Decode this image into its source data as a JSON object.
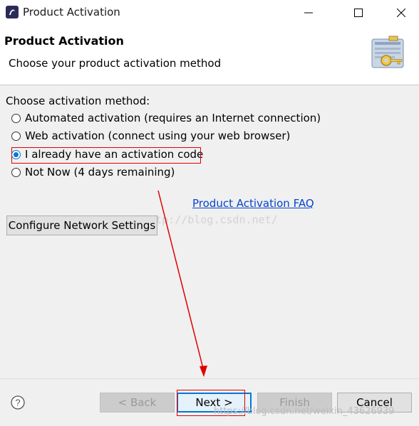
{
  "window": {
    "title": "Product Activation",
    "app_icon": "app-logo-icon",
    "controls": {
      "minimize": "minimize-icon",
      "maximize": "maximize-icon",
      "close": "close-icon"
    }
  },
  "header": {
    "title": "Product Activation",
    "subtitle": "Choose your product activation method",
    "icon": "license-key-icon"
  },
  "main": {
    "section_label": "Choose activation method:",
    "options": [
      {
        "label": "Automated activation (requires an Internet connection)",
        "checked": false
      },
      {
        "label": "Web activation (connect using your web browser)",
        "checked": false
      },
      {
        "label": "I already have an activation code",
        "checked": true
      },
      {
        "label": "Not Now (4 days remaining)",
        "checked": false
      }
    ],
    "faq_link": "Product Activation FAQ",
    "configure_button": "Configure Network Settings",
    "watermark": "http://blog.csdn.net/"
  },
  "footer": {
    "help_icon": "help-icon",
    "back": "< Back",
    "next": "Next >",
    "finish": "Finish",
    "cancel": "Cancel",
    "watermark": "https://blog.csdn.net/weixin_43626939"
  },
  "colors": {
    "accent": "#0078d7",
    "annotation_red": "#e00000",
    "link": "#0645cc"
  }
}
